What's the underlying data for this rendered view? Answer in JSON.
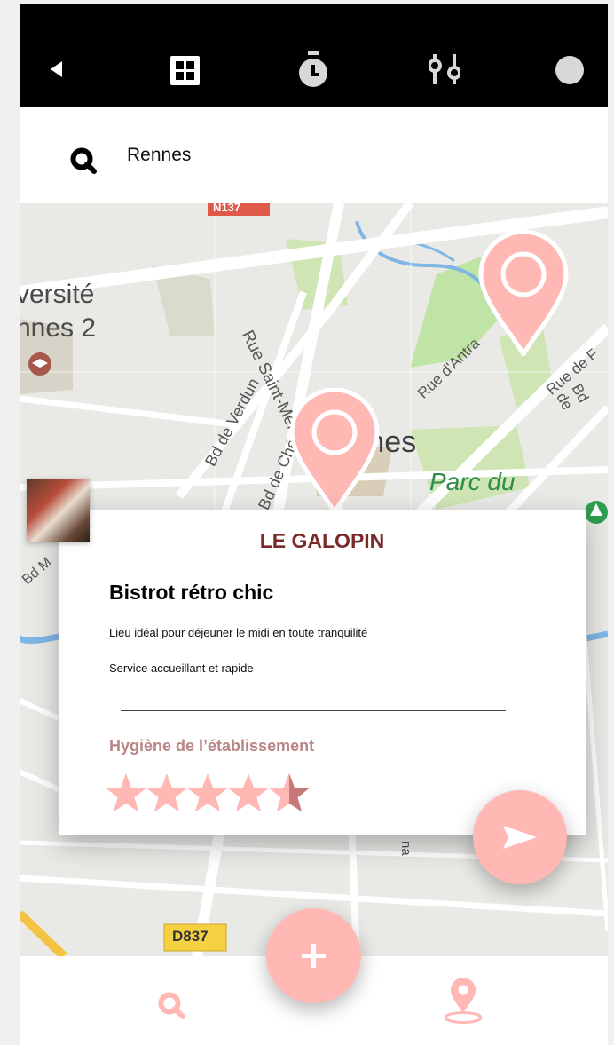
{
  "search": {
    "query": "Rennes"
  },
  "map": {
    "labels": {
      "road_n137": "N137",
      "universite_line1": "versité",
      "universite_line2": "nnes 2",
      "rue_saint_melaine": "Rue Saint-Mel",
      "bd_de_verdun": "Bd de Verdun",
      "bd_de_chezy": "Bd de Ché",
      "city": "Rennes",
      "rue_antrain": "Rue d'Antra",
      "rue_de_f": "Rue de F",
      "bd_de": "Bd de",
      "parc_du": "Parc du",
      "bd_m": "Bd M",
      "road_d837": "D837",
      "na": "na"
    }
  },
  "card": {
    "name": "LE GALOPIN",
    "type": "Bistrot rétro chic",
    "description_1": "Lieu idéal pour déjeuner le midi en toute tranquilité",
    "description_2": "Service accueillant et rapide",
    "hygiene_label": "Hygiène de l’établissement",
    "hygiene_rating": 4.5,
    "hygiene_max": 5
  },
  "colors": {
    "accent": "#ffb8b4",
    "title": "#7b2a2a",
    "hygiene_label": "#b98585",
    "star_fill": "#ffb8b4",
    "star_half": "#c97878",
    "topbar": "#000000"
  },
  "icons": {
    "topbar": [
      "back-arrow-icon",
      "grid-icon",
      "timer-icon",
      "sliders-icon",
      "profile-circle-icon"
    ],
    "search": "search-icon",
    "send": "send-icon",
    "add": "plus-icon",
    "bottom_nav": [
      "search-icon",
      "location-pin-icon"
    ]
  }
}
